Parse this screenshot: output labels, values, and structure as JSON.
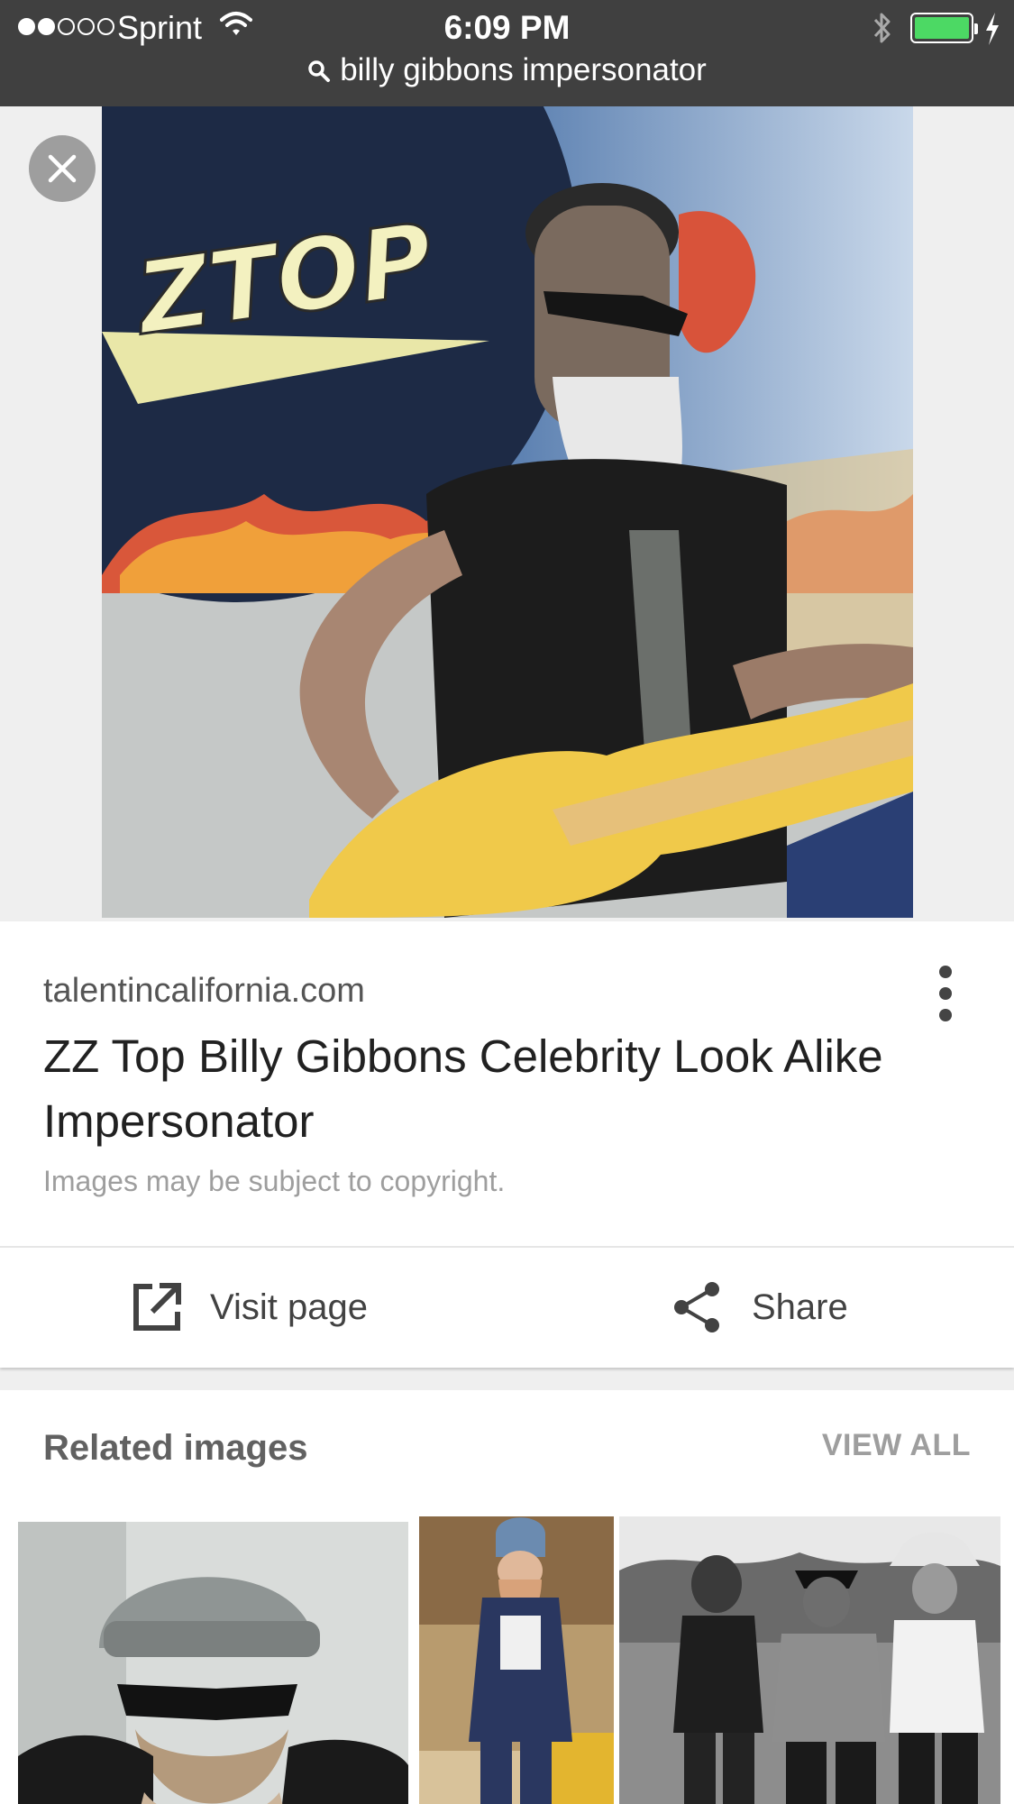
{
  "status": {
    "carrier": "Sprint",
    "time": "6:09 PM",
    "signal_bars": 2,
    "battery_level": 1.0
  },
  "search": {
    "query": "billy gibbons impersonator",
    "icon": "search-icon"
  },
  "result": {
    "source": "talentincalifornia.com",
    "title": "ZZ Top Billy Gibbons Celebrity Look Alike Impersonator",
    "copyright": "Images may be subject to copyright.",
    "visit_label": "Visit page",
    "share_label": "Share",
    "poster_text": "ZTOP"
  },
  "related": {
    "heading": "Related images",
    "view_all": "VIEW ALL"
  },
  "colors": {
    "status_bar": "#404040",
    "battery": "#4cd964",
    "card": "#ffffff",
    "background": "#efefef"
  }
}
